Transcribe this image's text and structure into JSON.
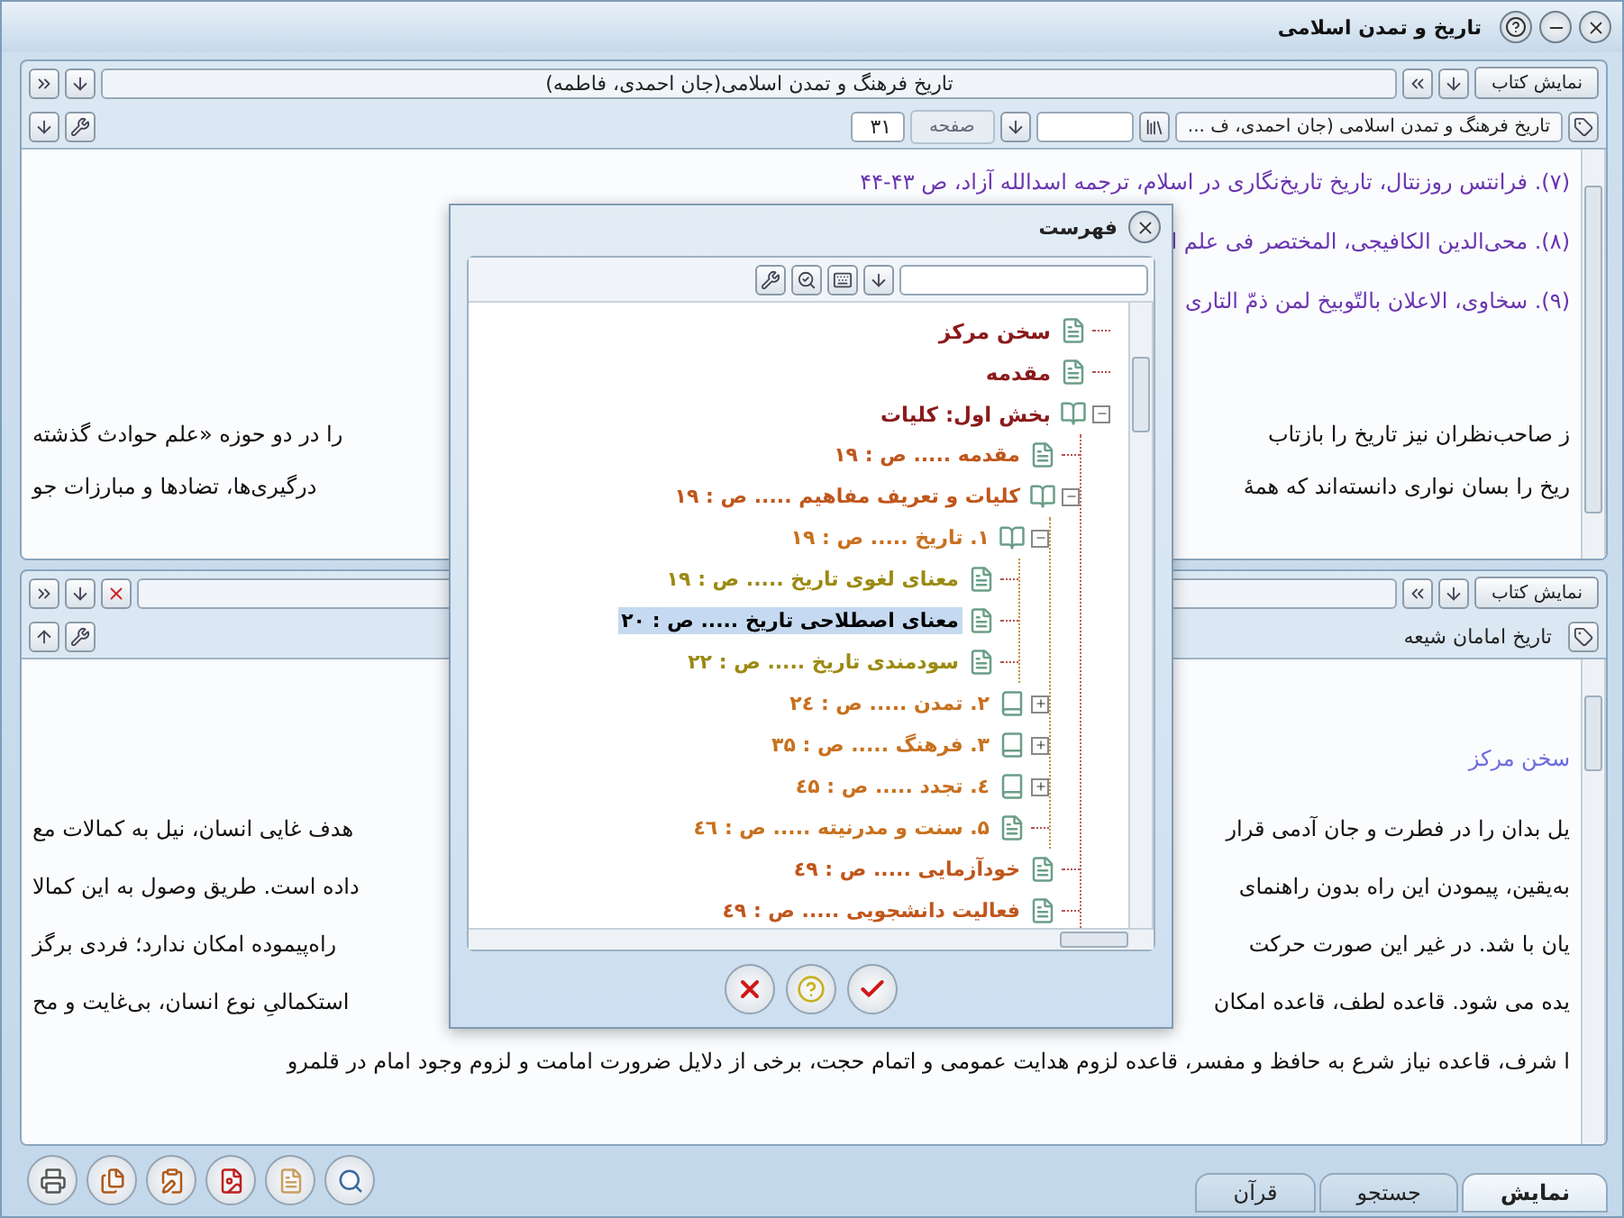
{
  "window": {
    "title": "تاریخ و تمدن اسلامی"
  },
  "upper_panel": {
    "show_book_button": "نمایش کتاب",
    "book_title": "تاریخ فرهنگ و تمدن اسلامی(جان احمدی، فاطمه)",
    "book_field": "تاریخ فرهنگ و تمدن اسلامی (جان احمدی، ف ...",
    "page_label": "صفحه",
    "page_value": "۳۱",
    "footnotes": [
      {
        "text": "(۷). فرانتس روزنتال، تاریخ تاریخ‌نگاری در اسلام، ترجمه اسدالله آزاد، ص ۴۳-۴۴"
      },
      {
        "text": "(۸). محی‌الدین الکافیجی، المختصر فی علم ا"
      },
      {
        "text": "(۹). سخاوی، الاعلان بالتّوبیخ لمن ذمّ التاری"
      }
    ],
    "paragraph_lines": [
      {
        "right_part": "ز صاحب‌نظران نیز تاریخ را بازتاب",
        "left_part": "را در دو حوزه «علم حوادث گذشته"
      },
      {
        "right_part": "ریخ را بسان نواری دانسته‌اند که همهٔ",
        "left_part": "درگیری‌ها، تضادها و مبارزات جو"
      }
    ]
  },
  "lower_panel": {
    "show_book_button": "نمایش کتاب",
    "book_field": "تاریخ امامان شیعه",
    "heading": "سخن مرکز",
    "paragraph_lines": [
      {
        "right_part": "یل بدان را در فطرت و جان آدمی قرار",
        "left_part": "هدف غایی انسان، نیل به کمالات مع"
      },
      {
        "right_part": "به‌یقین، پیمودن این راه بدون راهنمای",
        "left_part": "داده است. طریق وصول به این کمالا"
      },
      {
        "right_part": "یان با شد. در غیر این صورت حرکت",
        "left_part": "راه‌پیموده امکان ندارد؛ فردی برگز"
      },
      {
        "right_part": "یده می شود. قاعده لطف، قاعده امکان",
        "left_part": "استکمالیِ نوع انسان، بی‌غایت و مح"
      }
    ],
    "last_line": "ا شرف، قاعده نیاز شرع به حافظ و مفسر، قاعده لزوم هدایت عمومی و اتمام حجت، برخی از دلایل ضرورت امامت و لزوم وجود امام در قلمرو"
  },
  "dialog": {
    "title": "فهرست",
    "tree": [
      {
        "label": "سخن مرکز",
        "kind": "doc",
        "selected": false
      },
      {
        "label": "مقدمه",
        "kind": "doc",
        "selected": false
      },
      {
        "label": "بخش اول: کلیات",
        "kind": "book",
        "expanded": true,
        "selected": false,
        "children": [
          {
            "label": "مقدمه ..... ص : ۱۹",
            "kind": "doc",
            "selected": false
          },
          {
            "label": "کلیات و تعریف مفاهیم ..... ص : ۱۹",
            "kind": "book",
            "expanded": true,
            "selected": false,
            "children": [
              {
                "label": "۱. تاریخ ..... ص : ۱۹",
                "kind": "book",
                "expanded": true,
                "selected": false,
                "children": [
                  {
                    "label": "معنای لغوی تاریخ ..... ص : ۱۹",
                    "kind": "doc",
                    "selected": false
                  },
                  {
                    "label": "معنای اصطلاحی تاریخ ..... ص : ۲۰",
                    "kind": "doc",
                    "selected": true
                  },
                  {
                    "label": "سودمندی تاریخ ..... ص : ۲۲",
                    "kind": "doc",
                    "selected": false
                  }
                ]
              },
              {
                "label": "۲. تمدن ..... ص : ۲٤",
                "kind": "book",
                "expanded": false,
                "selected": false
              },
              {
                "label": "۳. فرهنگ ..... ص : ۳۵",
                "kind": "book",
                "expanded": false,
                "selected": false
              },
              {
                "label": "٤. تجدد ..... ص : ٤۵",
                "kind": "book",
                "expanded": false,
                "selected": false
              },
              {
                "label": "۵. سنت و مدرنیته ..... ص : ٤٦",
                "kind": "doc",
                "selected": false
              }
            ]
          },
          {
            "label": "خودآزمایی ..... ص : ٤۹",
            "kind": "doc",
            "selected": false
          },
          {
            "label": "فعالیت دانشجویی ..... ص : ٤۹",
            "kind": "doc",
            "selected": false
          }
        ]
      }
    ]
  },
  "bottom_tabs": [
    {
      "label": "نمایش",
      "selected": true
    },
    {
      "label": "جستجو",
      "selected": false
    },
    {
      "label": "قرآن",
      "selected": false
    }
  ]
}
